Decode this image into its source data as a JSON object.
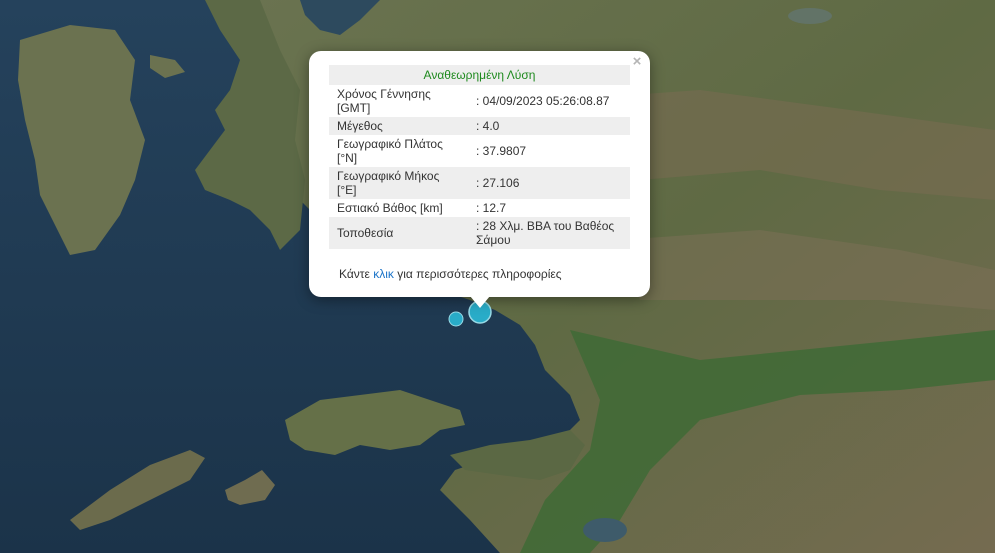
{
  "popup": {
    "header": "Αναθεωρημένη Λύση",
    "close_label": "×",
    "rows": [
      {
        "label": "Χρόνος Γέννησης [GMT]",
        "value": ": 04/09/2023 05:26:08.87"
      },
      {
        "label": "Μέγεθος",
        "value": ": 4.0"
      },
      {
        "label": "Γεωγραφικό Πλάτος [°N]",
        "value": ": 37.9807"
      },
      {
        "label": "Γεωγραφικό Μήκος [°E]",
        "value": ": 27.106"
      },
      {
        "label": "Εστιακό Βάθος [km]",
        "value": ": 12.7"
      },
      {
        "label": "Τοποθεσία",
        "value": ": 28 Χλμ. ΒΒΑ του Βαθέος Σάμου"
      }
    ],
    "footer_prefix": "Κάντε ",
    "footer_link": "κλικ",
    "footer_suffix": " για περισσότερες πληροφορίες"
  },
  "colors": {
    "sea": "#1f3a52",
    "land": "#5d6b45",
    "marker": "#2ab3cf",
    "header_text": "#1e8a1e",
    "link": "#1a73c8"
  }
}
